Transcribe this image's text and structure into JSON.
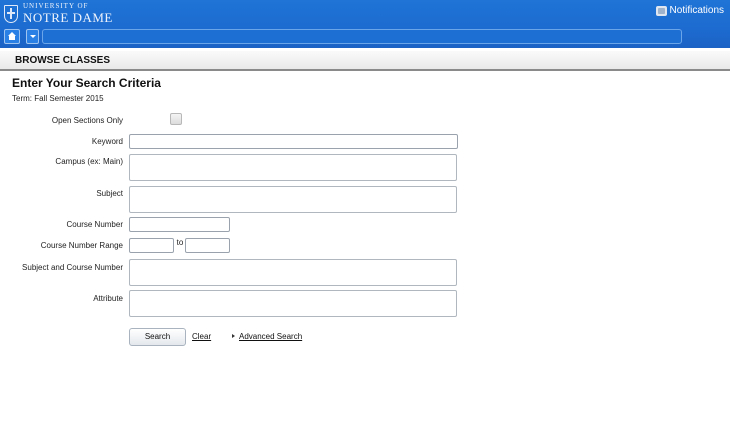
{
  "header": {
    "logo_line1": "UNIVERSITY OF",
    "logo_line2": "NOTRE DAME",
    "notifications_label": "Notifications"
  },
  "section": {
    "title": "BROWSE CLASSES"
  },
  "page": {
    "title": "Enter Your Search Criteria",
    "term": "Term: Fall Semester 2015"
  },
  "form": {
    "open_sections_label": "Open Sections Only",
    "keyword_label": "Keyword",
    "campus_label": "Campus (ex: Main)",
    "subject_label": "Subject",
    "course_number_label": "Course Number",
    "course_number_range_label": "Course Number Range",
    "range_to": "to",
    "subject_course_label": "Subject and Course Number",
    "attribute_label": "Attribute"
  },
  "actions": {
    "search_label": "Search",
    "clear_label": "Clear",
    "advanced_label": "Advanced Search"
  },
  "colors": {
    "header_blue": "#1d6bd0",
    "section_rule": "#8a8a8a"
  }
}
